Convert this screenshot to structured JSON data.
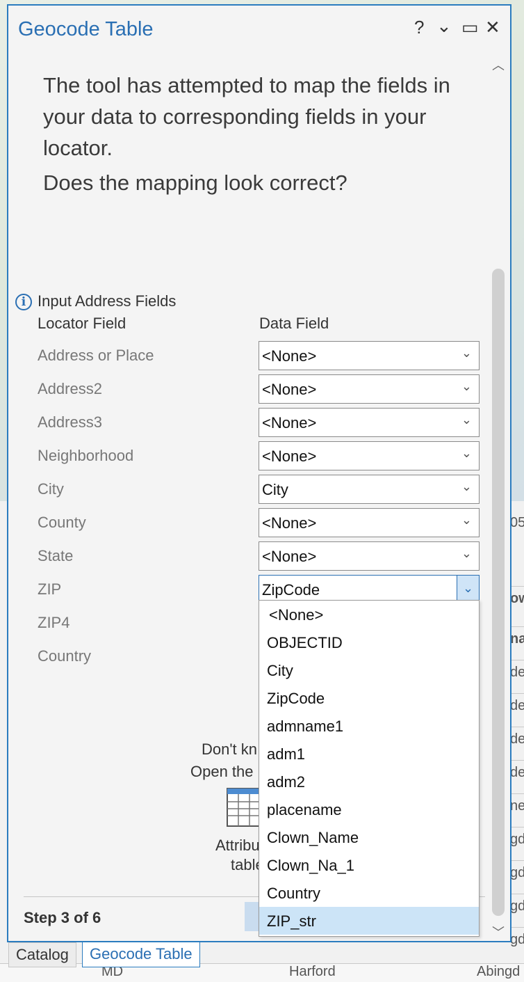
{
  "window": {
    "title": "Geocode Table",
    "help_glyph": "?",
    "menu_glyph": "⌄",
    "maximize_glyph": "▭",
    "close_glyph": "✕"
  },
  "intro": {
    "line1": "The tool has attempted to map the fields in",
    "line2": "your data to corresponding fields in your",
    "line3": "locator.",
    "question": "Does the mapping look correct?"
  },
  "section": {
    "title": "Input Address Fields",
    "locator_col": "Locator Field",
    "data_col": "Data Field"
  },
  "rows": [
    {
      "label": "Address or Place",
      "value": "<None>"
    },
    {
      "label": "Address2",
      "value": "<None>"
    },
    {
      "label": "Address3",
      "value": "<None>"
    },
    {
      "label": "Neighborhood",
      "value": "<None>"
    },
    {
      "label": "City",
      "value": "City"
    },
    {
      "label": "County",
      "value": "<None>"
    },
    {
      "label": "State",
      "value": "<None>"
    },
    {
      "label": "ZIP",
      "value": "ZipCode"
    },
    {
      "label": "ZIP4",
      "value": ""
    },
    {
      "label": "Country",
      "value": ""
    }
  ],
  "dropdown_options": [
    "<None>",
    "OBJECTID",
    "City",
    "ZipCode",
    "admname1",
    "adm1",
    "adm2",
    "placename",
    "Clown_Name",
    "Clown_Na_1",
    "Country",
    "ZIP_str"
  ],
  "dropdown_highlighted": "ZIP_str",
  "help": {
    "line1": "Don't kn",
    "line2": "Open the",
    "attr1": "Attribu",
    "attr2": "table"
  },
  "footer": {
    "step": "Step 3 of 6"
  },
  "tabs": [
    "Catalog",
    "Geocode Table"
  ],
  "background": {
    "cells": [
      "05",
      "ow",
      "na",
      "de",
      "de",
      "de",
      "de",
      "ne",
      "gd",
      "gd",
      "gd",
      "gd"
    ],
    "bottom_row": [
      "MD",
      "Harford",
      "Abingd"
    ]
  },
  "colors": {
    "accent": "#2a6fb3",
    "selection": "#cce4f7"
  }
}
